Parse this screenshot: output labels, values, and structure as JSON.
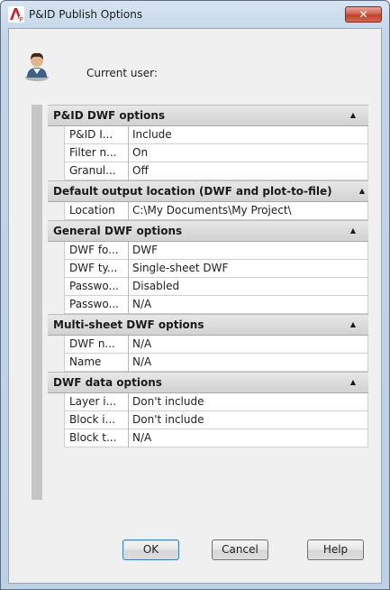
{
  "window": {
    "title": "P&ID Publish Options",
    "close_glyph": "✕"
  },
  "user": {
    "label": "Current user:"
  },
  "categories": [
    {
      "title": "P&ID DWF options",
      "rows": [
        {
          "name": "P&ID I...",
          "value": "Include"
        },
        {
          "name": "Filter n...",
          "value": "On"
        },
        {
          "name": "Granul...",
          "value": "Off"
        }
      ]
    },
    {
      "title": "Default output location (DWF and plot-to-file)",
      "rows": [
        {
          "name": "Location",
          "value": "C:\\My Documents\\My Project\\"
        }
      ]
    },
    {
      "title": "General DWF options",
      "rows": [
        {
          "name": "DWF fo...",
          "value": "DWF"
        },
        {
          "name": "DWF ty...",
          "value": "Single-sheet DWF"
        },
        {
          "name": "Passwo...",
          "value": "Disabled"
        },
        {
          "name": "Passwo...",
          "value": "N/A"
        }
      ]
    },
    {
      "title": "Multi-sheet DWF options",
      "rows": [
        {
          "name": "DWF n...",
          "value": "N/A"
        },
        {
          "name": "Name",
          "value": "N/A"
        }
      ]
    },
    {
      "title": "DWF data options",
      "rows": [
        {
          "name": "Layer i...",
          "value": "Don't include"
        },
        {
          "name": "Block i...",
          "value": "Don't include"
        },
        {
          "name": "Block t...",
          "value": "N/A"
        }
      ]
    }
  ],
  "buttons": {
    "ok": "OK",
    "cancel": "Cancel",
    "help": "Help"
  },
  "icons": {
    "app": "autocad-app-icon",
    "user": "user-avatar-icon",
    "collapse": "collapse-caret-icon"
  },
  "colors": {
    "titlebar": "#c3d5e9",
    "close_button": "#c0402a",
    "category_header": "#d2d2d2",
    "dialog_bg": "#f0f0f0"
  }
}
